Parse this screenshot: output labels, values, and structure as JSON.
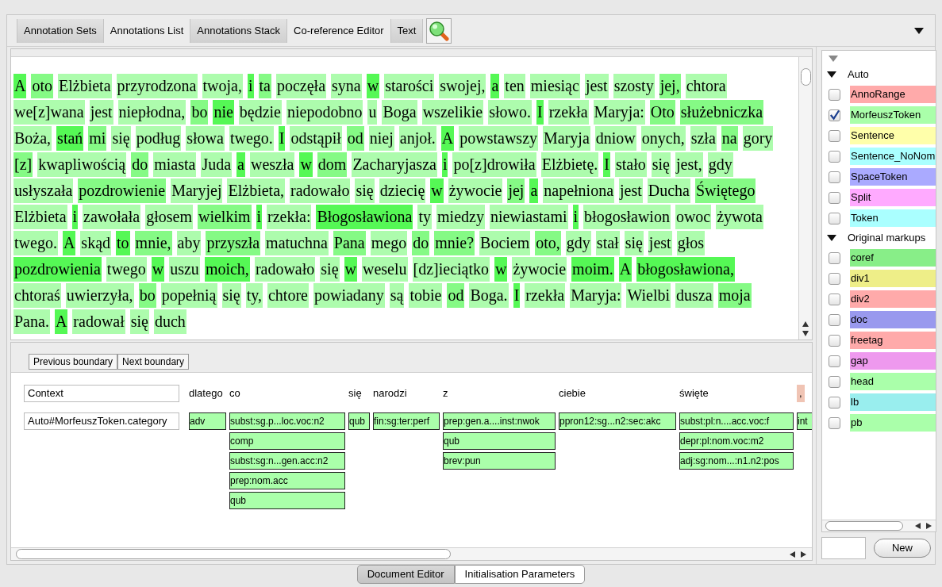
{
  "toolbar": {
    "tabs": [
      {
        "label": "Annotation Sets",
        "selected": true
      },
      {
        "label": "Annotations List",
        "selected": false
      },
      {
        "label": "Annotations Stack",
        "selected": true
      },
      {
        "label": "Co-reference Editor",
        "selected": false
      },
      {
        "label": "Text",
        "selected": true
      }
    ]
  },
  "text": {
    "lines": [
      [
        {
          "w": "A",
          "color": "#55f855"
        },
        {
          "w": "oto",
          "color": "#85fa85"
        },
        {
          "w": "Elżbieta",
          "color": "#adfcad"
        },
        {
          "w": "przyrodzona",
          "color": "#adfcad"
        },
        {
          "w": "twoja,",
          "color": "#adfcad"
        },
        {
          "w": "i",
          "color": "#55f855"
        },
        {
          "w": "ta",
          "color": "#85fa85"
        },
        {
          "w": "poczęła",
          "color": "#adfcad"
        },
        {
          "w": "syna",
          "color": "#adfcad"
        },
        {
          "w": "w",
          "color": "#55f855"
        },
        {
          "w": "starości",
          "color": "#adfcad"
        },
        {
          "w": "swojej,",
          "color": "#adfcad"
        },
        {
          "w": "a",
          "color": "#55f855"
        },
        {
          "w": "ten",
          "color": "#adfcad"
        },
        {
          "w": "miesiąc",
          "color": "#adfcad"
        },
        {
          "w": "jest",
          "color": "#adfcad"
        },
        {
          "w": "szosty",
          "color": "#adfcad"
        },
        {
          "w": "jej,",
          "color": "#85fa85"
        },
        {
          "w": "chtora",
          "color": "#adfcad"
        }
      ],
      [
        {
          "w": "we[z]wana",
          "color": "#adfcad"
        },
        {
          "w": "jest",
          "color": "#adfcad"
        },
        {
          "w": "niepłodna,",
          "color": "#adfcad"
        },
        {
          "w": "bo",
          "color": "#85fa85"
        },
        {
          "w": "nie",
          "color": "#55f855"
        },
        {
          "w": "będzie",
          "color": "#adfcad"
        },
        {
          "w": "niepodobno",
          "color": "#adfcad"
        },
        {
          "w": "u",
          "color": "#adfcad"
        },
        {
          "w": "Boga",
          "color": "#adfcad"
        },
        {
          "w": "wszelikie",
          "color": "#adfcad"
        },
        {
          "w": "słowo.",
          "color": "#adfcad"
        },
        {
          "w": "I",
          "color": "#55f855"
        },
        {
          "w": "rzekła",
          "color": "#adfcad"
        },
        {
          "w": "Maryja:",
          "color": "#adfcad"
        },
        {
          "w": "Oto",
          "color": "#85fa85"
        },
        {
          "w": "służebniczka",
          "color": "#85fa85"
        }
      ],
      [
        {
          "w": "Boża,",
          "color": "#adfcad"
        },
        {
          "w": "stań",
          "color": "#55f855"
        },
        {
          "w": "mi",
          "color": "#85fa85"
        },
        {
          "w": "się",
          "color": "#adfcad"
        },
        {
          "w": "podług",
          "color": "#adfcad"
        },
        {
          "w": "słowa",
          "color": "#adfcad"
        },
        {
          "w": "twego.",
          "color": "#adfcad"
        },
        {
          "w": "I",
          "color": "#55f855"
        },
        {
          "w": "odstąpił",
          "color": "#adfcad"
        },
        {
          "w": "od",
          "color": "#85fa85"
        },
        {
          "w": "niej",
          "color": "#adfcad"
        },
        {
          "w": "anjoł.",
          "color": "#adfcad"
        },
        {
          "w": "A",
          "color": "#55f855"
        },
        {
          "w": "powstawszy",
          "color": "#adfcad"
        },
        {
          "w": "Maryja",
          "color": "#adfcad"
        },
        {
          "w": "dniow",
          "color": "#adfcad"
        },
        {
          "w": "onych,",
          "color": "#adfcad"
        },
        {
          "w": "szła",
          "color": "#adfcad"
        },
        {
          "w": "na",
          "color": "#85fa85"
        },
        {
          "w": "gory",
          "color": "#adfcad"
        }
      ],
      [
        {
          "w": "[z]",
          "color": "#85fa85"
        },
        {
          "w": "kwapliwością",
          "color": "#adfcad"
        },
        {
          "w": "do",
          "color": "#85fa85"
        },
        {
          "w": "miasta",
          "color": "#adfcad"
        },
        {
          "w": "Juda",
          "color": "#adfcad"
        },
        {
          "w": "a",
          "color": "#55f855"
        },
        {
          "w": "weszła",
          "color": "#adfcad"
        },
        {
          "w": "w",
          "color": "#55f855"
        },
        {
          "w": "dom",
          "color": "#85fa85"
        },
        {
          "w": "Zacharyjasza",
          "color": "#adfcad"
        },
        {
          "w": "i",
          "color": "#55f855"
        },
        {
          "w": "po[z]drowiła",
          "color": "#adfcad"
        },
        {
          "w": "Elżbietę.",
          "color": "#adfcad"
        },
        {
          "w": "I",
          "color": "#55f855"
        },
        {
          "w": "stało",
          "color": "#adfcad"
        },
        {
          "w": "się",
          "color": "#adfcad"
        },
        {
          "w": "jest,",
          "color": "#adfcad"
        },
        {
          "w": "gdy",
          "color": "#adfcad"
        }
      ],
      [
        {
          "w": "usłyszała",
          "color": "#adfcad"
        },
        {
          "w": "pozdrowienie",
          "color": "#85fa85"
        },
        {
          "w": "Maryjej",
          "color": "#adfcad"
        },
        {
          "w": "Elżbieta,",
          "color": "#adfcad"
        },
        {
          "w": "radowało",
          "color": "#adfcad"
        },
        {
          "w": "się",
          "color": "#adfcad"
        },
        {
          "w": "dziecię",
          "color": "#adfcad"
        },
        {
          "w": "w",
          "color": "#55f855"
        },
        {
          "w": "żywocie",
          "color": "#adfcad"
        },
        {
          "w": "jej",
          "color": "#85fa85"
        },
        {
          "w": "a",
          "color": "#55f855"
        },
        {
          "w": "napełniona",
          "color": "#adfcad"
        },
        {
          "w": "jest",
          "color": "#adfcad"
        },
        {
          "w": "Ducha",
          "color": "#adfcad"
        },
        {
          "w": "Świętego",
          "color": "#85fa85"
        }
      ],
      [
        {
          "w": "Elżbieta",
          "color": "#adfcad"
        },
        {
          "w": "i",
          "color": "#55f855"
        },
        {
          "w": "zawołała",
          "color": "#adfcad"
        },
        {
          "w": "głosem",
          "color": "#adfcad"
        },
        {
          "w": "wielkim",
          "color": "#85fa85"
        },
        {
          "w": "i",
          "color": "#55f855"
        },
        {
          "w": "rzekła:",
          "color": "#adfcad"
        },
        {
          "w": "Błogosławiona",
          "color": "#55f855"
        },
        {
          "w": "ty",
          "color": "#adfcad"
        },
        {
          "w": "miedzy",
          "color": "#adfcad"
        },
        {
          "w": "niewiastami",
          "color": "#adfcad"
        },
        {
          "w": "i",
          "color": "#55f855"
        },
        {
          "w": "błogosławion",
          "color": "#adfcad"
        },
        {
          "w": "owoc",
          "color": "#adfcad"
        },
        {
          "w": "żywota",
          "color": "#adfcad"
        }
      ],
      [
        {
          "w": "twego.",
          "color": "#adfcad"
        },
        {
          "w": "A",
          "color": "#55f855"
        },
        {
          "w": "skąd",
          "color": "#adfcad"
        },
        {
          "w": "to",
          "color": "#55f855"
        },
        {
          "w": "mnie,",
          "color": "#85fa85"
        },
        {
          "w": "aby",
          "color": "#adfcad"
        },
        {
          "w": "przyszła",
          "color": "#85fa85"
        },
        {
          "w": "matuchna",
          "color": "#adfcad"
        },
        {
          "w": "Pana",
          "color": "#85fa85"
        },
        {
          "w": "mego",
          "color": "#adfcad"
        },
        {
          "w": "do",
          "color": "#85fa85"
        },
        {
          "w": "mnie?",
          "color": "#85fa85"
        },
        {
          "w": "Bociem",
          "color": "#adfcad"
        },
        {
          "w": "oto,",
          "color": "#85fa85"
        },
        {
          "w": "gdy",
          "color": "#adfcad"
        },
        {
          "w": "stał",
          "color": "#adfcad"
        },
        {
          "w": "się",
          "color": "#adfcad"
        },
        {
          "w": "jest",
          "color": "#adfcad"
        },
        {
          "w": "głos",
          "color": "#adfcad"
        }
      ],
      [
        {
          "w": "pozdrowienia",
          "color": "#55f855"
        },
        {
          "w": "twego",
          "color": "#adfcad"
        },
        {
          "w": "w",
          "color": "#55f855"
        },
        {
          "w": "uszu",
          "color": "#adfcad"
        },
        {
          "w": "moich,",
          "color": "#55f855"
        },
        {
          "w": "radowało",
          "color": "#adfcad"
        },
        {
          "w": "się",
          "color": "#adfcad"
        },
        {
          "w": "w",
          "color": "#55f855"
        },
        {
          "w": "weselu",
          "color": "#adfcad"
        },
        {
          "w": "[dz]ieciątko",
          "color": "#adfcad"
        },
        {
          "w": "w",
          "color": "#55f855"
        },
        {
          "w": "żywocie",
          "color": "#adfcad"
        },
        {
          "w": "moim.",
          "color": "#55f855"
        },
        {
          "w": "A",
          "color": "#55f855"
        },
        {
          "w": "błogosławiona,",
          "color": "#55f855"
        }
      ],
      [
        {
          "w": "chtoraś",
          "color": "#adfcad"
        },
        {
          "w": "uwierzyła,",
          "color": "#adfcad"
        },
        {
          "w": "bo",
          "color": "#85fa85"
        },
        {
          "w": "popełnią",
          "color": "#adfcad"
        },
        {
          "w": "się",
          "color": "#adfcad"
        },
        {
          "w": "ty,",
          "color": "#adfcad"
        },
        {
          "w": "chtore",
          "color": "#adfcad"
        },
        {
          "w": "powiadany",
          "color": "#adfcad"
        },
        {
          "w": "są",
          "color": "#adfcad"
        },
        {
          "w": "tobie",
          "color": "#adfcad"
        },
        {
          "w": "od",
          "color": "#85fa85"
        },
        {
          "w": "Boga.",
          "color": "#adfcad"
        },
        {
          "w": "I",
          "color": "#55f855"
        },
        {
          "w": "rzekła",
          "color": "#adfcad"
        },
        {
          "w": "Maryja:",
          "color": "#adfcad"
        },
        {
          "w": "Wielbi",
          "color": "#adfcad"
        },
        {
          "w": "dusza",
          "color": "#adfcad"
        },
        {
          "w": "moja",
          "color": "#85fa85"
        }
      ],
      [
        {
          "w": "Pana.",
          "color": "#adfcad"
        },
        {
          "w": "A",
          "color": "#55f855"
        },
        {
          "w": "radował",
          "color": "#adfcad"
        },
        {
          "w": "się",
          "color": "#adfcad"
        },
        {
          "w": "duch",
          "color": "#adfcad"
        }
      ]
    ]
  },
  "stack": {
    "buttons": [
      "Previous boundary",
      "Next boundary"
    ],
    "context_label": "Context",
    "row_label": "Auto#MorfeuszToken.category",
    "columns": [
      {
        "word": "dlatego",
        "categories": [
          "adv"
        ]
      },
      {
        "word": "co",
        "categories": [
          "subst:sg.p...loc.voc:n2",
          "comp",
          "subst:sg:n...gen.acc:n2",
          "prep:nom.acc",
          "qub"
        ]
      },
      {
        "word": "się",
        "categories": [
          "qub"
        ]
      },
      {
        "word": "narodzi",
        "categories": [
          "fin:sg:ter:perf"
        ]
      },
      {
        "word": "z",
        "categories": [
          "prep:gen.a....inst:nwok",
          "qub",
          "brev:pun"
        ]
      },
      {
        "word": "ciebie",
        "categories": [
          "ppron12:sg...n2:sec:akc"
        ]
      },
      {
        "word": "święte",
        "categories": [
          "subst:pl:n....acc.voc:f",
          "depr:pl:nom.voc:m2",
          "adj:sg:nom...:n1.n2:pos"
        ]
      },
      {
        "word": ",",
        "categories": [
          "int"
        ]
      }
    ]
  },
  "annotation_sets": [
    {
      "name": "Auto",
      "expanded": true,
      "types": [
        {
          "name": "AnnoRange",
          "checked": false,
          "color": "#ffaaaa"
        },
        {
          "name": "MorfeuszToken",
          "checked": true,
          "color": "#aaffaa"
        },
        {
          "name": "Sentence",
          "checked": false,
          "color": "#ffffaa"
        },
        {
          "name": "Sentence_NoNom",
          "checked": false,
          "color": "#aaffff"
        },
        {
          "name": "SpaceToken",
          "checked": false,
          "color": "#aaaaff"
        },
        {
          "name": "Split",
          "checked": false,
          "color": "#ffaaff"
        },
        {
          "name": "Token",
          "checked": false,
          "color": "#aaffff"
        }
      ]
    },
    {
      "name": "Original markups",
      "expanded": true,
      "types": [
        {
          "name": "coref",
          "checked": false,
          "color": "#88ee88"
        },
        {
          "name": "div1",
          "checked": false,
          "color": "#eeee88"
        },
        {
          "name": "div2",
          "checked": false,
          "color": "#ffaaaa"
        },
        {
          "name": "doc",
          "checked": false,
          "color": "#9999ee"
        },
        {
          "name": "freetag",
          "checked": false,
          "color": "#ffaaaa"
        },
        {
          "name": "gap",
          "checked": false,
          "color": "#ee99ee"
        },
        {
          "name": "head",
          "checked": false,
          "color": "#aaffaa"
        },
        {
          "name": "lb",
          "checked": false,
          "color": "#99eeee"
        },
        {
          "name": "pb",
          "checked": false,
          "color": "#aaffaa"
        }
      ]
    }
  ],
  "new_button": "New",
  "bottom_tabs": [
    {
      "label": "Document Editor",
      "selected": true
    },
    {
      "label": "Initialisation Parameters",
      "selected": false
    }
  ]
}
